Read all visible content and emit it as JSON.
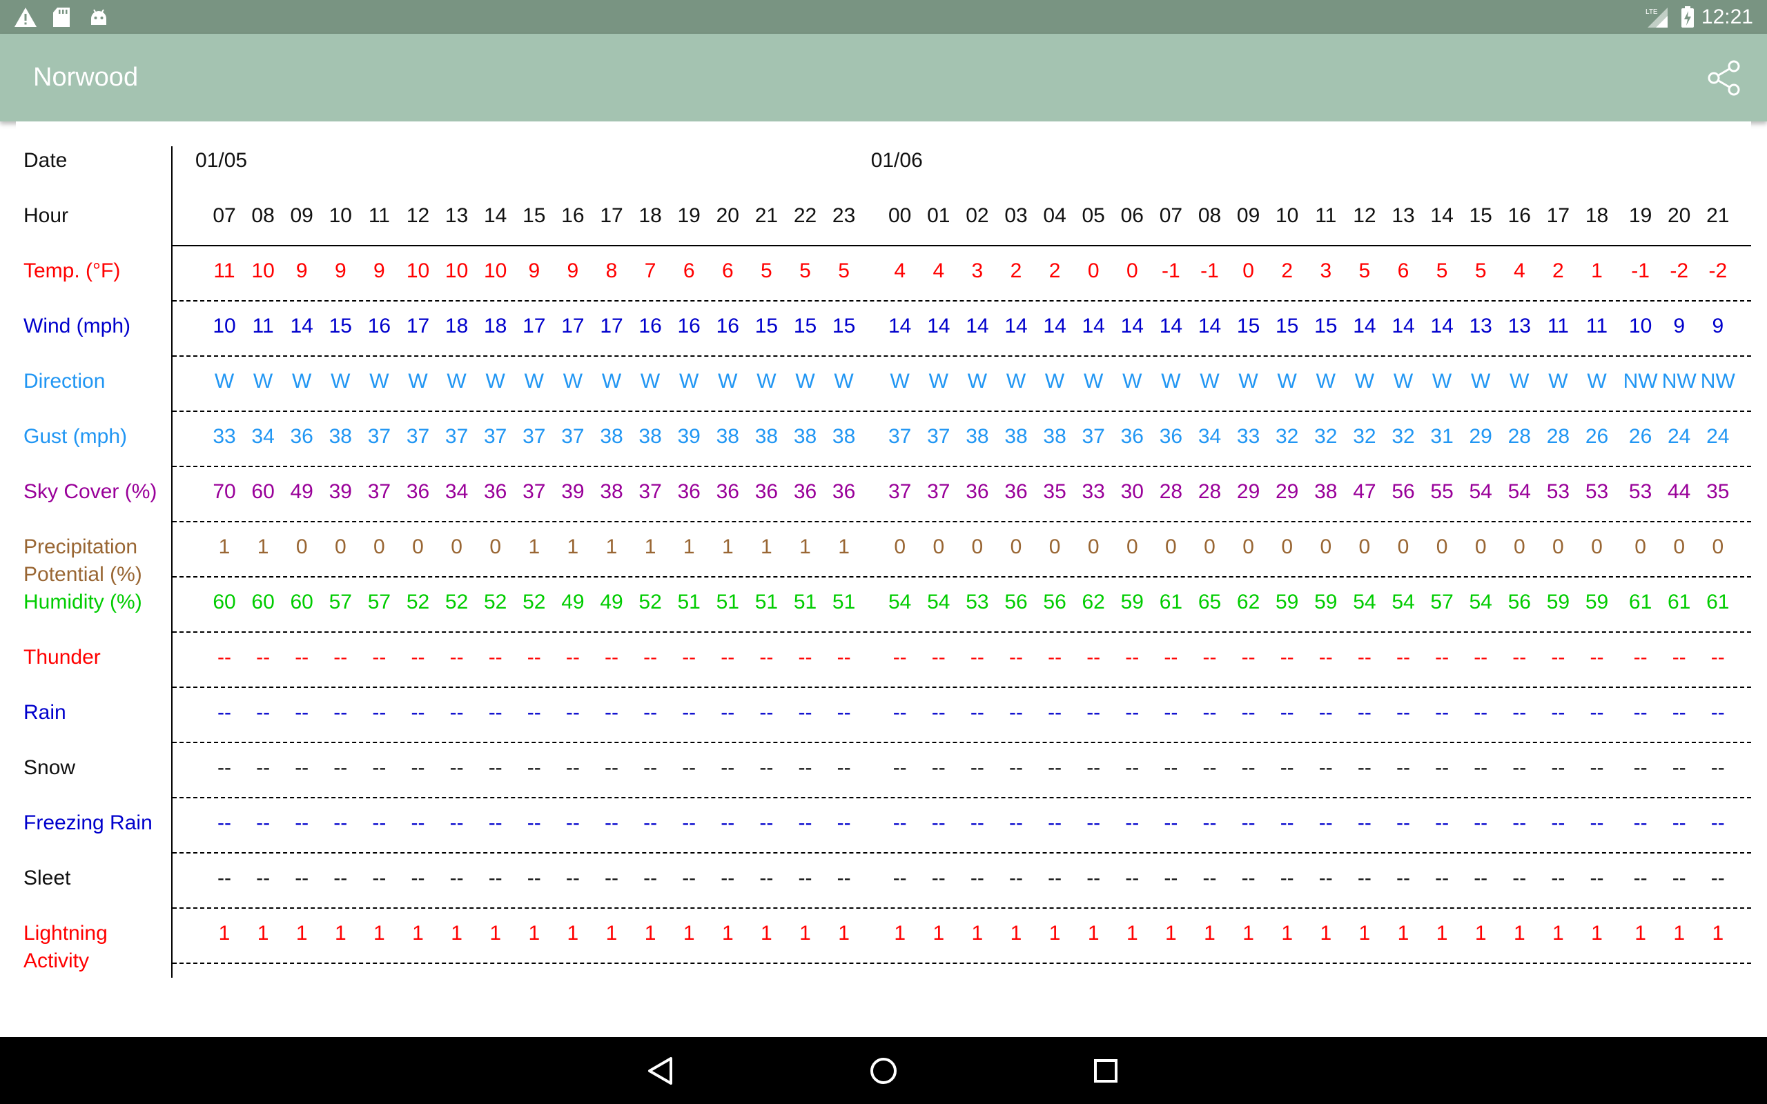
{
  "status_bar": {
    "time": "12:21",
    "network": "LTE"
  },
  "app_bar": {
    "title": "Norwood"
  },
  "table": {
    "dates": [
      {
        "label": "01/05",
        "col": 0
      },
      {
        "label": "01/06",
        "col": 17
      }
    ],
    "rows": [
      {
        "key": "hour",
        "label": "Hour",
        "color": "#111111",
        "values": [
          "07",
          "08",
          "09",
          "10",
          "11",
          "12",
          "13",
          "14",
          "15",
          "16",
          "17",
          "18",
          "19",
          "20",
          "21",
          "22",
          "23",
          "00",
          "01",
          "02",
          "03",
          "04",
          "05",
          "06",
          "07",
          "08",
          "09",
          "10",
          "11",
          "12",
          "13",
          "14",
          "15",
          "16",
          "17",
          "18",
          "19",
          "20",
          "21"
        ]
      },
      {
        "key": "temp",
        "label": "Temp. (°F)",
        "color": "#ff0000",
        "values": [
          "11",
          "10",
          "9",
          "9",
          "9",
          "10",
          "10",
          "10",
          "9",
          "9",
          "8",
          "7",
          "6",
          "6",
          "5",
          "5",
          "5",
          "4",
          "4",
          "3",
          "2",
          "2",
          "0",
          "0",
          "-1",
          "-1",
          "0",
          "2",
          "3",
          "5",
          "6",
          "5",
          "5",
          "4",
          "2",
          "1",
          "-1",
          "-2",
          "-2"
        ]
      },
      {
        "key": "wind",
        "label": "Wind (mph)",
        "color": "#0000cc",
        "values": [
          "10",
          "11",
          "14",
          "15",
          "16",
          "17",
          "18",
          "18",
          "17",
          "17",
          "17",
          "16",
          "16",
          "16",
          "15",
          "15",
          "15",
          "14",
          "14",
          "14",
          "14",
          "14",
          "14",
          "14",
          "14",
          "14",
          "15",
          "15",
          "15",
          "14",
          "14",
          "14",
          "13",
          "13",
          "11",
          "11",
          "10",
          "9",
          "9"
        ]
      },
      {
        "key": "direction",
        "label": "Direction",
        "color": "#2196f3",
        "values": [
          "W",
          "W",
          "W",
          "W",
          "W",
          "W",
          "W",
          "W",
          "W",
          "W",
          "W",
          "W",
          "W",
          "W",
          "W",
          "W",
          "W",
          "W",
          "W",
          "W",
          "W",
          "W",
          "W",
          "W",
          "W",
          "W",
          "W",
          "W",
          "W",
          "W",
          "W",
          "W",
          "W",
          "W",
          "W",
          "W",
          "NW",
          "NW",
          "NW"
        ]
      },
      {
        "key": "gust",
        "label": "Gust (mph)",
        "color": "#2196f3",
        "values": [
          "33",
          "34",
          "36",
          "38",
          "37",
          "37",
          "37",
          "37",
          "37",
          "37",
          "38",
          "38",
          "39",
          "38",
          "38",
          "38",
          "38",
          "37",
          "37",
          "38",
          "38",
          "38",
          "37",
          "36",
          "36",
          "34",
          "33",
          "32",
          "32",
          "32",
          "32",
          "31",
          "29",
          "28",
          "28",
          "26",
          "26",
          "24",
          "24"
        ]
      },
      {
        "key": "sky",
        "label": "Sky Cover (%)",
        "color": "#990099",
        "values": [
          "70",
          "60",
          "49",
          "39",
          "37",
          "36",
          "34",
          "36",
          "37",
          "39",
          "38",
          "37",
          "36",
          "36",
          "36",
          "36",
          "36",
          "37",
          "37",
          "36",
          "36",
          "35",
          "33",
          "30",
          "28",
          "28",
          "29",
          "29",
          "38",
          "47",
          "56",
          "55",
          "54",
          "54",
          "53",
          "53",
          "53",
          "44",
          "35"
        ]
      },
      {
        "key": "precip",
        "label": "Precipitation Potential (%)",
        "color": "#996633",
        "values": [
          "1",
          "1",
          "0",
          "0",
          "0",
          "0",
          "0",
          "0",
          "1",
          "1",
          "1",
          "1",
          "1",
          "1",
          "1",
          "1",
          "1",
          "0",
          "0",
          "0",
          "0",
          "0",
          "0",
          "0",
          "0",
          "0",
          "0",
          "0",
          "0",
          "0",
          "0",
          "0",
          "0",
          "0",
          "0",
          "0",
          "0",
          "0",
          "0"
        ]
      },
      {
        "key": "humidity",
        "label": "Humidity (%)",
        "color": "#00cc00",
        "values": [
          "60",
          "60",
          "60",
          "57",
          "57",
          "52",
          "52",
          "52",
          "52",
          "49",
          "49",
          "52",
          "51",
          "51",
          "51",
          "51",
          "51",
          "54",
          "54",
          "53",
          "56",
          "56",
          "62",
          "59",
          "61",
          "65",
          "62",
          "59",
          "59",
          "54",
          "54",
          "57",
          "54",
          "56",
          "59",
          "59",
          "61",
          "61",
          "61"
        ]
      },
      {
        "key": "thunder",
        "label": "Thunder",
        "color": "#ff0000",
        "fill": "--"
      },
      {
        "key": "rain",
        "label": "Rain",
        "color": "#0000cc",
        "fill": "--"
      },
      {
        "key": "snow",
        "label": "Snow",
        "color": "#111111",
        "fill": "--"
      },
      {
        "key": "freezing",
        "label": "Freezing Rain",
        "color": "#0000cc",
        "fill": "--"
      },
      {
        "key": "sleet",
        "label": "Sleet",
        "color": "#111111",
        "fill": "--"
      },
      {
        "key": "lightning",
        "label": "Lightning Activity",
        "color": "#ff0000",
        "fill": "1"
      }
    ],
    "date_label": "Date",
    "date_color": "#111111"
  },
  "colors": {
    "status_bar": "#799482",
    "app_bar": "#a4c3b1"
  }
}
